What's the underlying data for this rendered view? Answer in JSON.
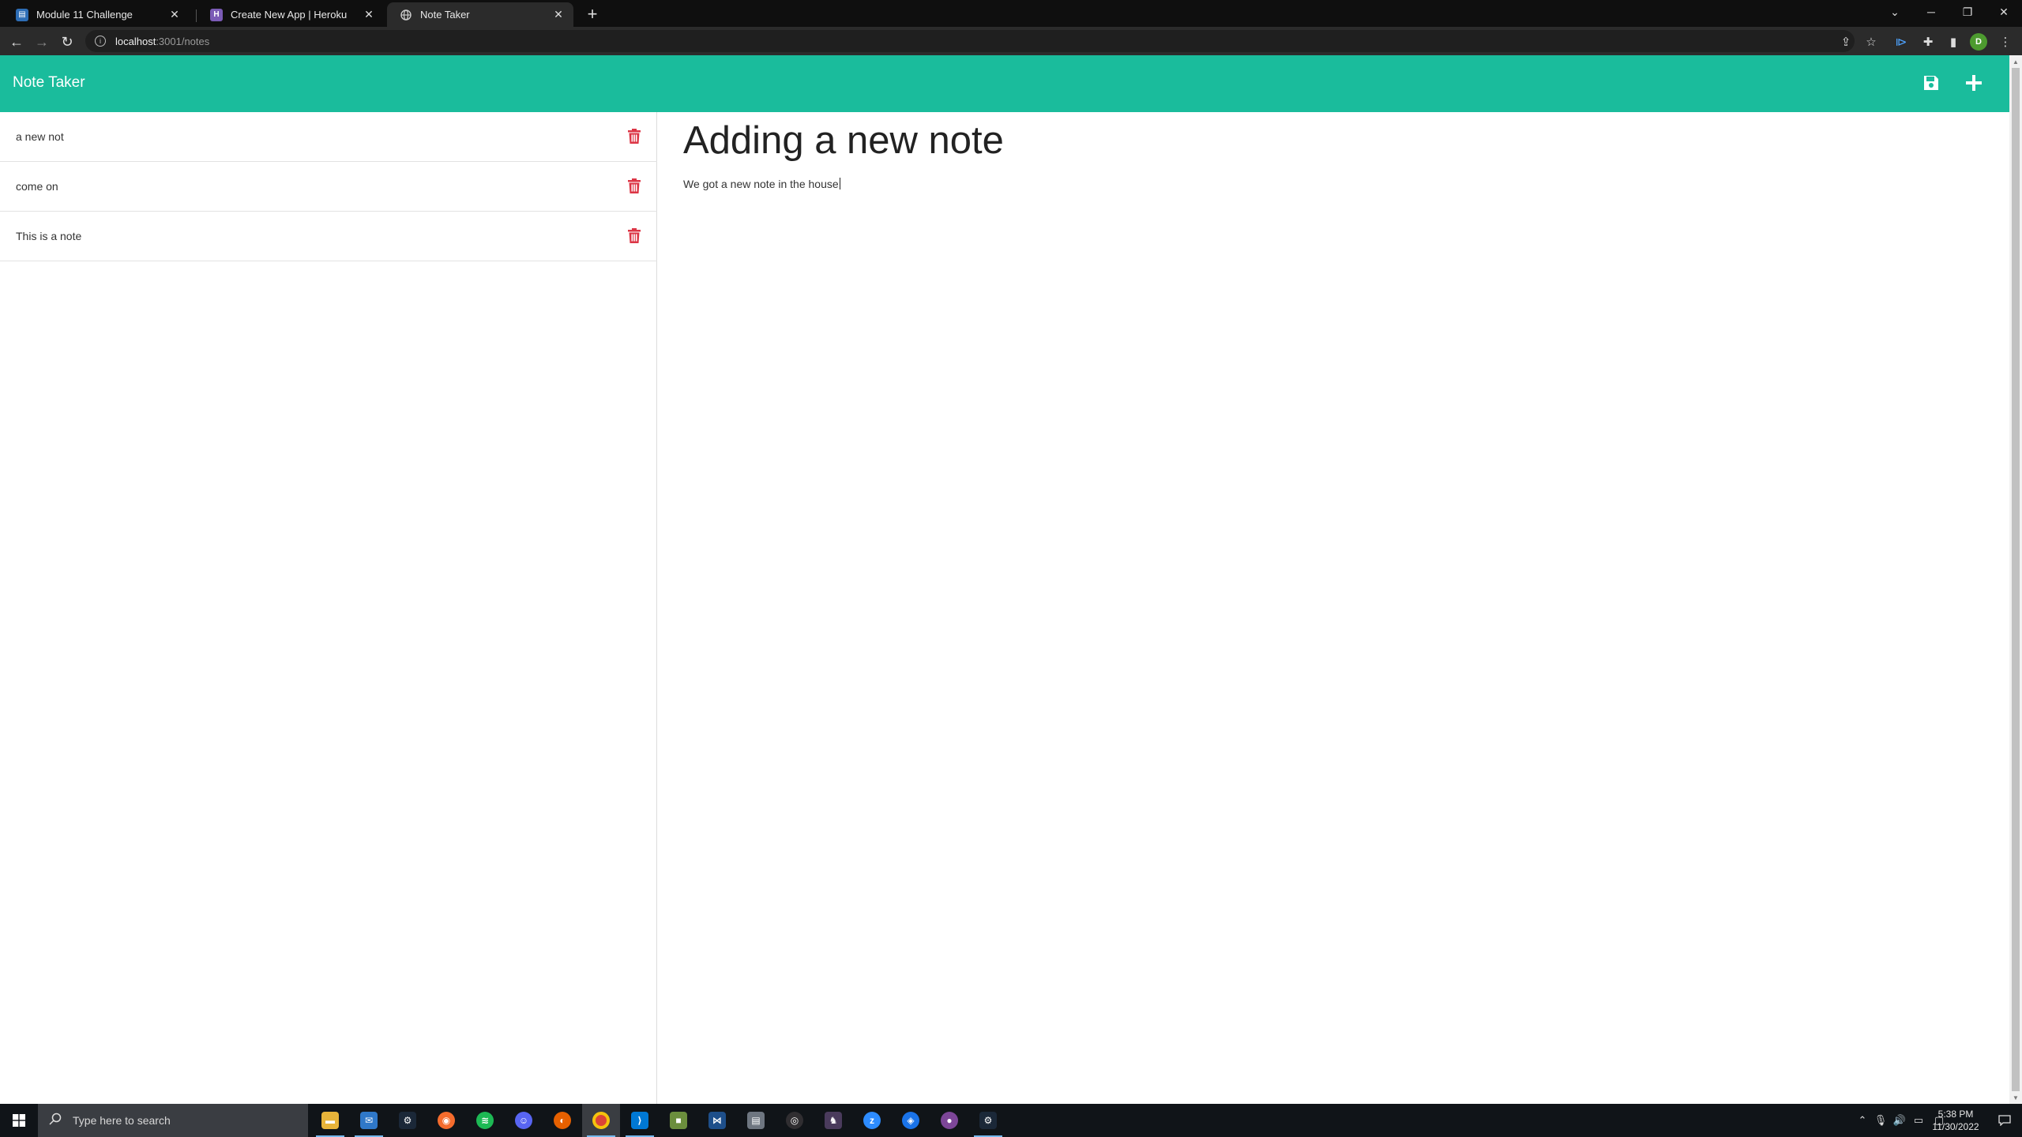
{
  "browser": {
    "tabs": [
      {
        "title": "Module 11 Challenge",
        "favicon": "document-icon",
        "active": false
      },
      {
        "title": "Create New App | Heroku",
        "favicon": "heroku-icon",
        "active": false
      },
      {
        "title": "Note Taker",
        "favicon": "globe-icon",
        "active": true
      }
    ],
    "url_host": "localhost",
    "url_path": ":3001/notes",
    "profile_initial": "D"
  },
  "app": {
    "brand": "Note Taker",
    "accent_color": "#1abc9c",
    "delete_color": "#dc3545",
    "notes": [
      {
        "title": "a new not"
      },
      {
        "title": "come on"
      },
      {
        "title": "This is a note"
      }
    ],
    "editor": {
      "title": "Adding a new note",
      "body": "We got a new note in the house"
    }
  },
  "taskbar": {
    "search_placeholder": "Type here to search",
    "apps": [
      "file-explorer",
      "mail",
      "steam",
      "origin",
      "spotify",
      "discord",
      "firefox",
      "chrome",
      "vscode",
      "minecraft",
      "insomnia",
      "storage",
      "obs",
      "game",
      "zoom",
      "meet",
      "tor",
      "steam"
    ],
    "clock_time": "5:38 PM",
    "clock_date": "11/30/2022"
  }
}
